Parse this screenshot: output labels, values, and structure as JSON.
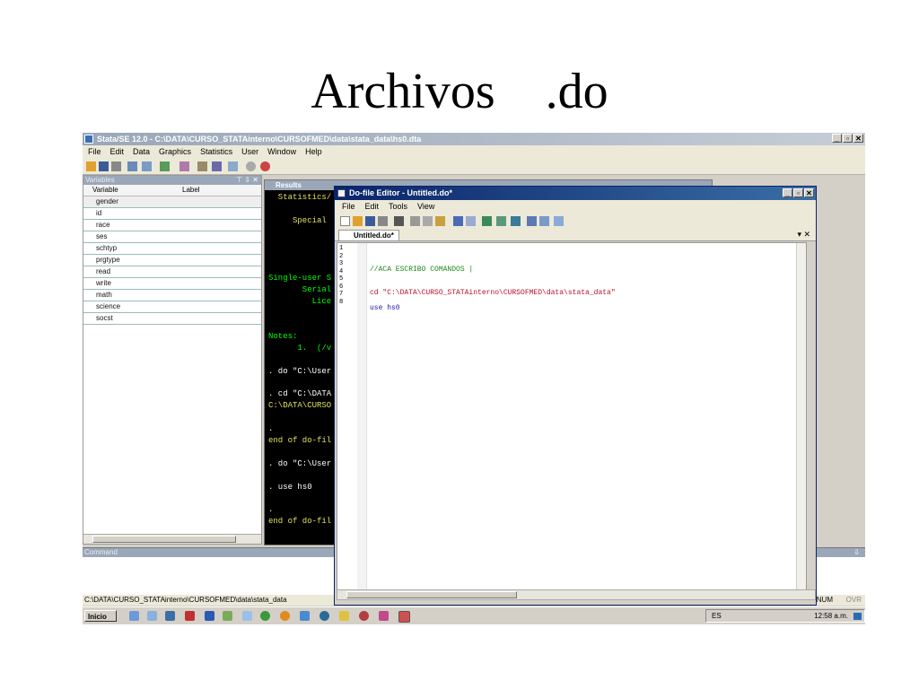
{
  "slide": {
    "title": "Archivos    .do"
  },
  "app": {
    "window_title": "Stata/SE 12.0 - C:\\DATA\\CURSO_STATAinterno\\CURSOFMED\\data\\stata_data\\hs0.dta",
    "menu": [
      "File",
      "Edit",
      "Data",
      "Graphics",
      "Statistics",
      "User",
      "Window",
      "Help"
    ]
  },
  "variables": {
    "pane_title": "Variables",
    "pane_controls": "⊤ ⇩ ✕",
    "col_variable": "Variable",
    "col_label": "Label",
    "items": [
      "gender",
      "id",
      "race",
      "ses",
      "schtyp",
      "prgtype",
      "read",
      "write",
      "math",
      "science",
      "socst"
    ]
  },
  "results": {
    "title": "Results",
    "lines": [
      "  Statistics/",
      "",
      "     Special",
      "",
      "",
      "",
      "",
      "Single-user S",
      "       Serial",
      "         Lice",
      "",
      "",
      "Notes:",
      "      1.  (/v",
      "",
      ". do \"C:\\User",
      "",
      ". cd \"C:\\DATA",
      "C:\\DATA\\CURSO",
      "",
      ".",
      "end of do-fil",
      "",
      ". do \"C:\\User",
      "",
      ". use hs0",
      "",
      ".",
      "end of do-fil",
      "",
      "."
    ]
  },
  "command": {
    "title": "Command",
    "ctl": "⇩"
  },
  "status": {
    "path": "C:\\DATA\\CURSO_STATAinterno\\CURSOFMED\\data\\stata_data",
    "num": "NUM",
    "ovr": "OVR"
  },
  "taskbar": {
    "start": "Inicio",
    "lang": "ES",
    "clock": "12:58 a.m."
  },
  "editor": {
    "title": "Do-file Editor - Untitled.do*",
    "menu": [
      "File",
      "Edit",
      "Tools",
      "View"
    ],
    "tab": "Untitled.do*",
    "tab_ctl": "▾ ✕",
    "line_numbers": [
      "1",
      "2",
      "3",
      "4",
      "5",
      "6",
      "7",
      "8"
    ],
    "code": [
      {
        "line": 3,
        "text": "//ACA ESCRIBO COMANDOS |",
        "color": "#1a8a1a"
      },
      {
        "line": 6,
        "text": "cd \"C:\\DATA\\CURSO_STATAinterno\\CURSOFMED\\data\\stata_data\"",
        "color": "#b8102a"
      },
      {
        "line": 8,
        "text": "use hs0",
        "color": "#1a1aa8"
      }
    ]
  },
  "colors": {
    "result_text": "#ffffff",
    "result_yellow": "#e0e060",
    "result_green": "#00ff00",
    "accent": "#0a246a"
  }
}
